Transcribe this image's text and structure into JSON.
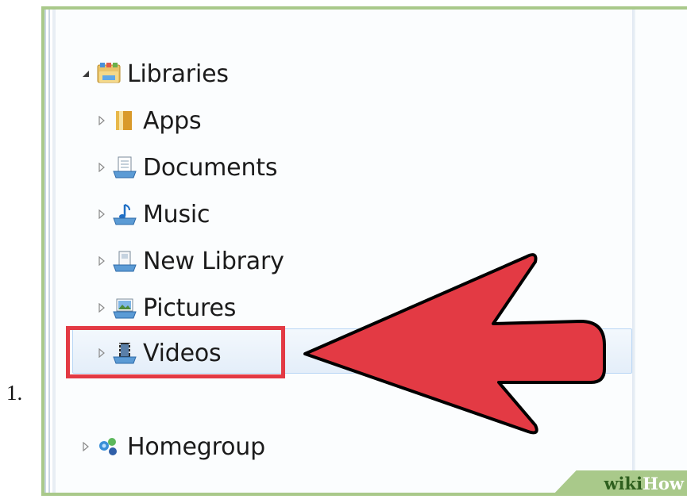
{
  "step_label": "1.",
  "tree": {
    "libraries": {
      "label": "Libraries",
      "expander": "expanded-triangle-icon",
      "icon": "libraries-icon"
    },
    "items": [
      {
        "label": "Apps",
        "icon": "folder-icon"
      },
      {
        "label": "Documents",
        "icon": "documents-library-icon"
      },
      {
        "label": "Music",
        "icon": "music-library-icon"
      },
      {
        "label": "New Library",
        "icon": "library-icon"
      },
      {
        "label": "Pictures",
        "icon": "pictures-library-icon"
      },
      {
        "label": "Videos",
        "icon": "videos-library-icon",
        "selected": true
      }
    ],
    "homegroup": {
      "label": "Homegroup",
      "icon": "homegroup-icon"
    }
  },
  "annotation": {
    "arrow_color": "#e33a44",
    "highlight_color": "#e33a44",
    "points_to": "Videos"
  },
  "watermark": {
    "part1": "wiki",
    "part2": "How"
  },
  "colors": {
    "frame_border": "#a9c98a",
    "selection_border": "#b8d6f5",
    "text": "#1b1b1b"
  }
}
